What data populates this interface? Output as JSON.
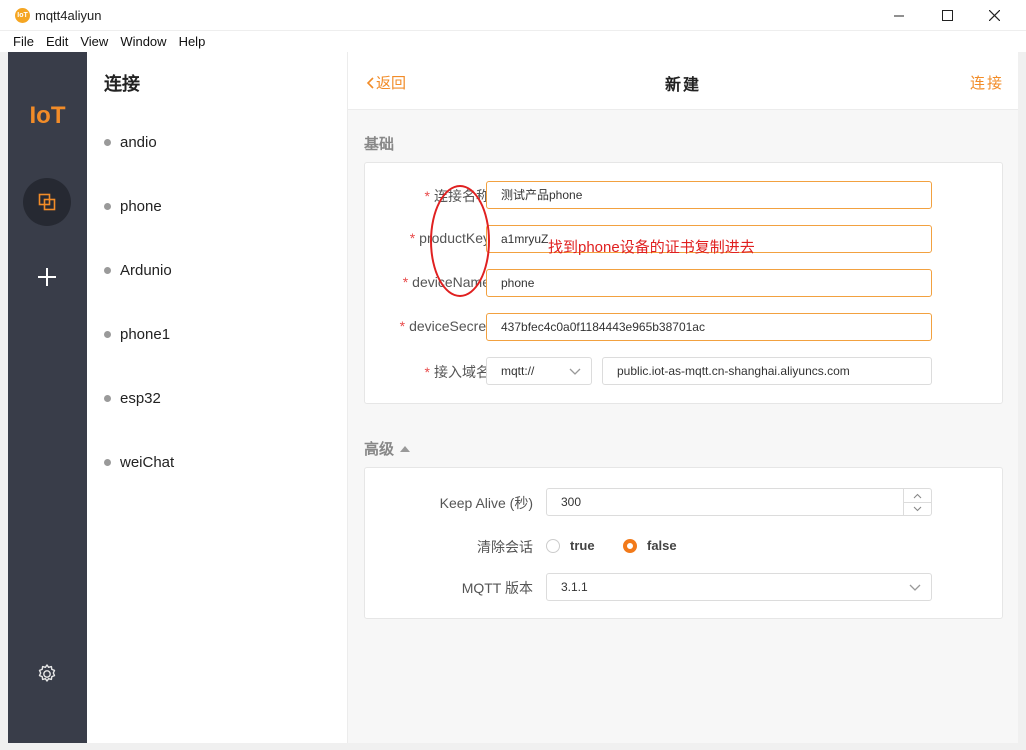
{
  "window": {
    "title": "mqtt4aliyun",
    "app_icon_text": "IoT"
  },
  "menu": [
    "File",
    "Edit",
    "View",
    "Window",
    "Help"
  ],
  "sidebar": {
    "logo": "IoT"
  },
  "connections": {
    "title": "连接",
    "items": [
      "andio",
      "phone",
      "Ardunio",
      "phone1",
      "esp32",
      "weiChat"
    ]
  },
  "header": {
    "back": "返回",
    "title": "新建",
    "connect": "连接"
  },
  "basic": {
    "section_label": "基础",
    "name_label": "连接名称",
    "name_value": "测试产品phone",
    "product_key_label": "productKey",
    "product_key_value": "a1mryuZ",
    "device_name_label": "deviceName",
    "device_name_value": "phone",
    "device_secret_label": "deviceSecret",
    "device_secret_value": "437bfec4c0a0f1184443e965b38701ac",
    "domain_label": "接入域名",
    "protocol_value": "mqtt://",
    "host_value": "public.iot-as-mqtt.cn-shanghai.aliyuncs.com",
    "required_mark": "*"
  },
  "advanced": {
    "section_label": "高级",
    "keep_alive_label": "Keep Alive (秒)",
    "keep_alive_value": "300",
    "clean_session_label": "清除会话",
    "option_true": "true",
    "option_false": "false",
    "selected": "false",
    "mqtt_version_label": "MQTT 版本",
    "mqtt_version_value": "3.1.1"
  },
  "annotation": {
    "text": "找到phone设备的证书复制进去"
  },
  "colors": {
    "accent": "#f28c28",
    "sidebar_bg": "#393d49",
    "required": "#e84a4a",
    "annotation": "#e02020"
  }
}
